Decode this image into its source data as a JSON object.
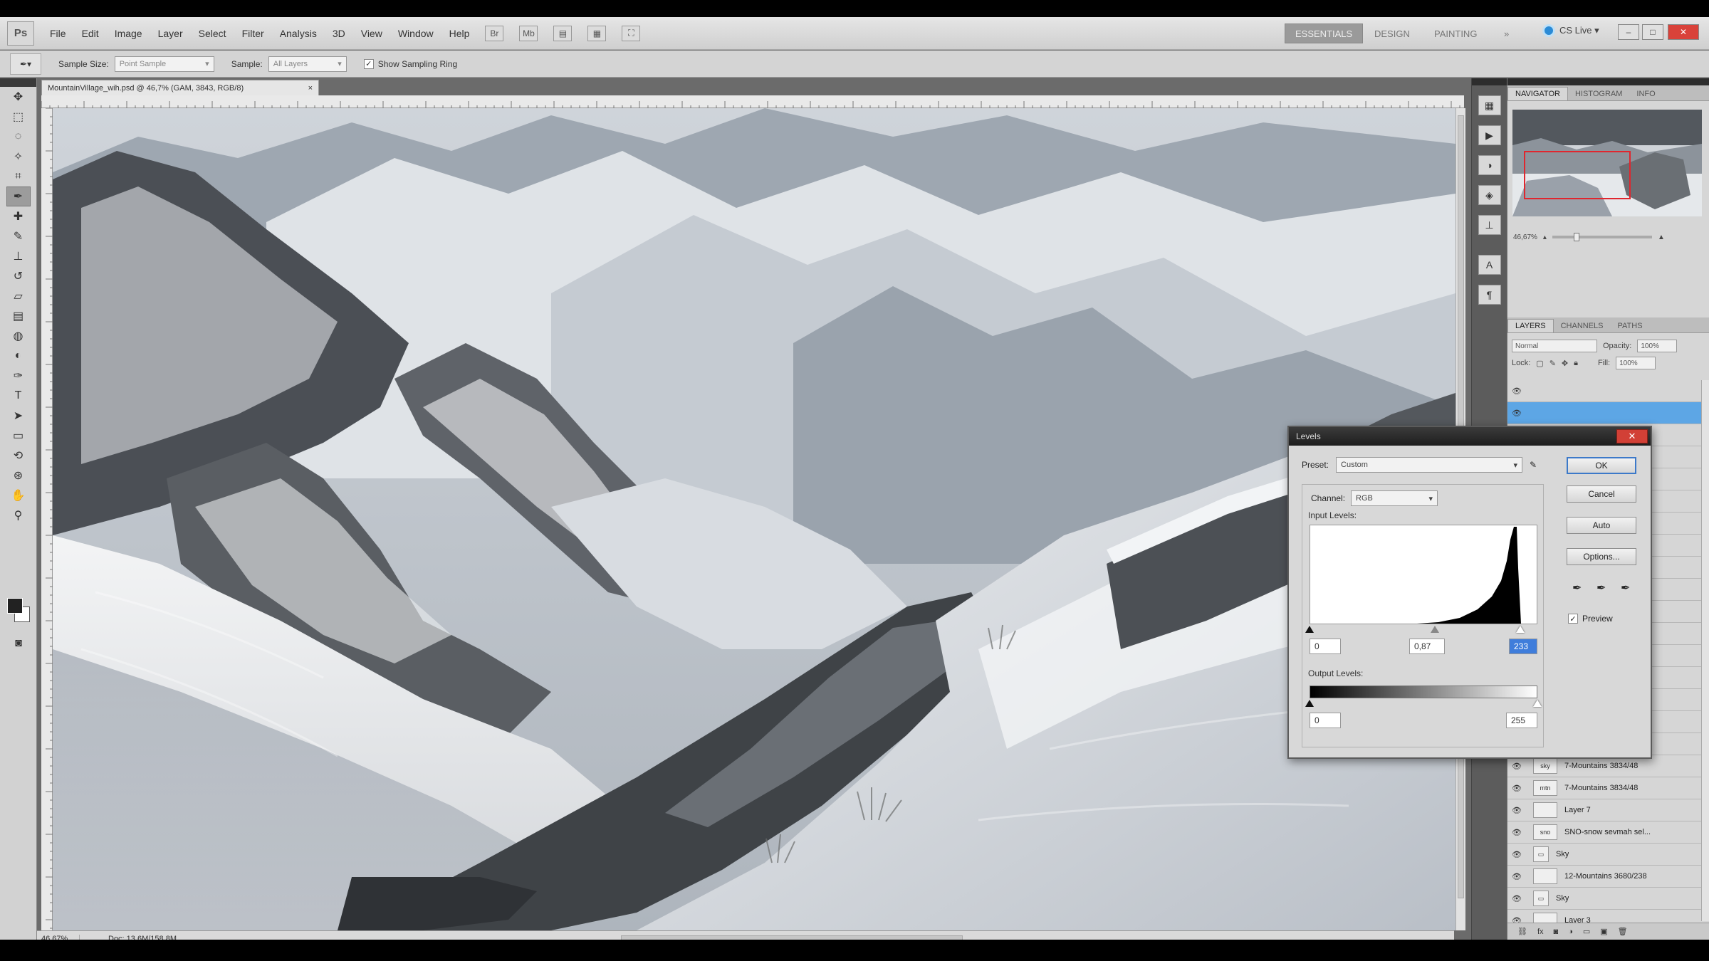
{
  "menubar": {
    "logo": "Ps",
    "menus": [
      "File",
      "Edit",
      "Image",
      "Layer",
      "Select",
      "Filter",
      "Analysis",
      "3D",
      "View",
      "Window",
      "Help"
    ],
    "workspaces": [
      "ESSENTIALS",
      "DESIGN",
      "PAINTING",
      "»"
    ],
    "cs_live": "CS Live ▾",
    "window_buttons": [
      "–",
      "□",
      "✕"
    ]
  },
  "options": {
    "sample_size_label": "Sample Size:",
    "sample_size_value": "Point Sample",
    "sample_label": "Sample:",
    "sample_value": "All Layers",
    "show_ring_label": "Show Sampling Ring",
    "show_ring_checked": "✓"
  },
  "document": {
    "tab_title": "MountainVillage_wih.psd @ 46,7% (GAM, 3843, RGB/8)",
    "tab_close": "×",
    "zoom": "46,67%",
    "doc_info": "Doc: 13,6M/158,8M"
  },
  "navigator": {
    "tabs": [
      "NAVIGATOR",
      "HISTOGRAM",
      "INFO"
    ],
    "zoom": "46,67%"
  },
  "layers_panel": {
    "tabs": [
      "LAYERS",
      "CHANNELS",
      "PATHS"
    ],
    "blend_mode": "Normal",
    "opacity_label": "Opacity:",
    "opacity_value": "100%",
    "lock_label": "Lock:",
    "fill_label": "Fill:",
    "fill_value": "100%",
    "layers": [
      {
        "name": "7-Mountains 3834/48",
        "thumb": "sky"
      },
      {
        "name": "7-Mountains 3834/48",
        "thumb": "mtn"
      },
      {
        "name": "Layer 7",
        "thumb": ""
      },
      {
        "name": "SNO-snow sevmah sel...",
        "thumb": "sno"
      },
      {
        "name": "Sky",
        "thumb": ""
      },
      {
        "name": "12-Mountains 3680/238",
        "thumb": ""
      },
      {
        "name": "Sky",
        "thumb": ""
      },
      {
        "name": "Layer 3",
        "thumb": ""
      }
    ],
    "footer_icons": [
      "link-icon",
      "fx-icon",
      "mask-icon",
      "adjustment-icon",
      "group-icon",
      "new-layer-icon",
      "trash-icon"
    ]
  },
  "levels_dialog": {
    "title": "Levels",
    "close": "✕",
    "preset_label": "Preset:",
    "preset_value": "Custom",
    "channel_label": "Channel:",
    "channel_value": "RGB",
    "input_label": "Input Levels:",
    "input_black": "0",
    "input_gamma": "0,87",
    "input_white": "233",
    "output_label": "Output Levels:",
    "output_black": "0",
    "output_white": "255",
    "buttons": {
      "ok": "OK",
      "cancel": "Cancel",
      "auto": "Auto",
      "options": "Options..."
    },
    "preview_label": "Preview",
    "preview_checked": "✓"
  }
}
